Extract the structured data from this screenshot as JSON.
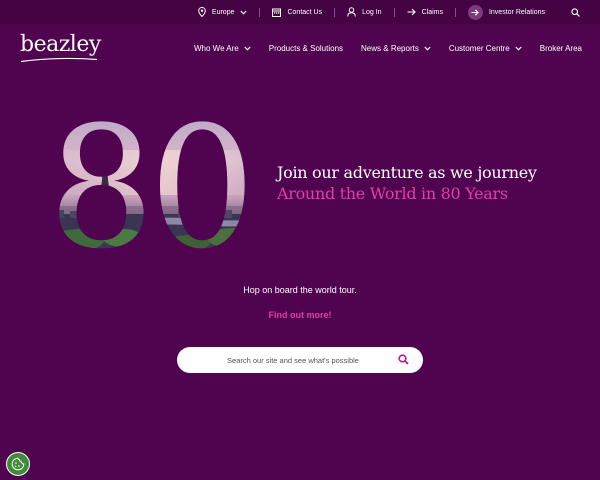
{
  "topbar": {
    "region": "Europe",
    "contact": "Contact Us",
    "login": "Log In",
    "claims": "Claims",
    "investor": "Investor Relations"
  },
  "nav": {
    "logo": "beazley",
    "items": [
      {
        "label": "Who We Are",
        "has_dropdown": true
      },
      {
        "label": "Products & Solutions",
        "has_dropdown": false
      },
      {
        "label": "News & Reports",
        "has_dropdown": true
      },
      {
        "label": "Customer Centre",
        "has_dropdown": true
      },
      {
        "label": "Broker Area",
        "has_dropdown": false
      }
    ]
  },
  "hero": {
    "big_number": "80",
    "headline_line1": "Join our adventure as we journey",
    "headline_line2": "Around the World in 80 Years",
    "subtext": "Hop on board the world tour.",
    "cta": "Find out more!"
  },
  "search": {
    "placeholder": "Search our site and see what's possible"
  },
  "colors": {
    "background": "#50034f",
    "topbar": "#440343",
    "accent_pink": "#e23fa8",
    "text": "#ffffff"
  },
  "icons": {
    "region": "location-pin-icon",
    "contact": "calendar-icon",
    "login": "user-icon",
    "claims": "arrow-right-icon",
    "investor": "arrow-right-circle-icon",
    "search": "search-icon",
    "cookie": "cookie-icon"
  }
}
